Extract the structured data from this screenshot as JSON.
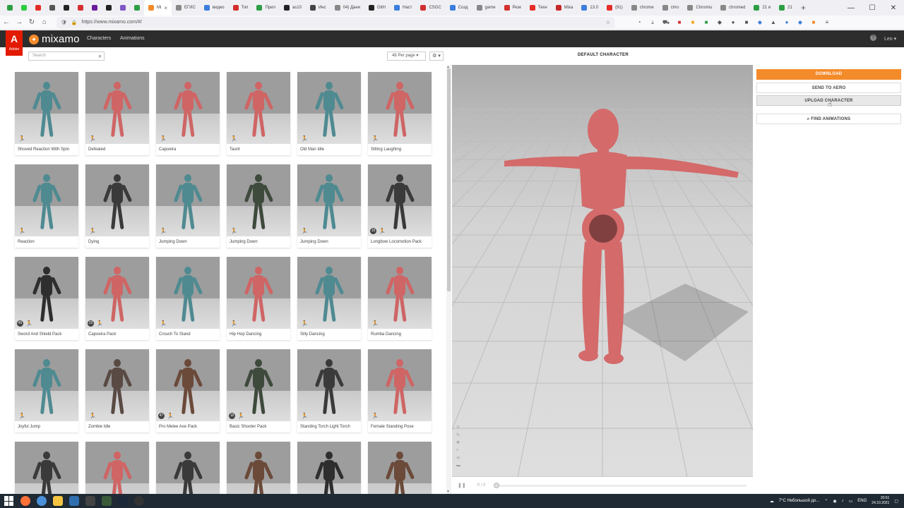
{
  "browser": {
    "tabs": [
      {
        "label": "",
        "color": "#2e9e44"
      },
      {
        "label": "",
        "color": "#2ecc40"
      },
      {
        "label": "",
        "color": "#e52d27"
      },
      {
        "label": "",
        "color": "#555555"
      },
      {
        "label": "",
        "color": "#222222"
      },
      {
        "label": "",
        "color": "#d32f2f"
      },
      {
        "label": "",
        "color": "#6a1b9a"
      },
      {
        "label": "",
        "color": "#222222"
      },
      {
        "label": "",
        "color": "#7e57c2"
      },
      {
        "label": "",
        "color": "#2e9e44"
      },
      {
        "label": "Mi",
        "color": "#f48b2b",
        "active": true
      },
      {
        "label": "ЕГИС",
        "color": "#888888"
      },
      {
        "label": "видео",
        "color": "#3b7ddd"
      },
      {
        "label": "Топ",
        "color": "#d32f2f"
      },
      {
        "label": "Прил",
        "color": "#2e9e44"
      },
      {
        "label": "as10",
        "color": "#222222"
      },
      {
        "label": "Инс",
        "color": "#444444"
      },
      {
        "label": "04) Дани",
        "color": "#888888"
      },
      {
        "label": "GitH",
        "color": "#222222"
      },
      {
        "label": "Наст",
        "color": "#3b7ddd"
      },
      {
        "label": "CSGC",
        "color": "#d32f2f"
      },
      {
        "label": "Созд",
        "color": "#3b7ddd"
      },
      {
        "label": "game",
        "color": "#888888"
      },
      {
        "label": "Резк",
        "color": "#d32f2f"
      },
      {
        "label": "Техн",
        "color": "#e52d27"
      },
      {
        "label": "Mixa",
        "color": "#c62828"
      },
      {
        "label": "13.0",
        "color": "#3b7ddd"
      },
      {
        "label": "(91)",
        "color": "#e52d27"
      },
      {
        "label": "chrome",
        "color": "#888888"
      },
      {
        "label": "chro",
        "color": "#888888"
      },
      {
        "label": "Chromiu",
        "color": "#888888"
      },
      {
        "label": "chromed",
        "color": "#888888"
      },
      {
        "label": "21 и",
        "color": "#2e9e44"
      },
      {
        "label": "21",
        "color": "#2e9e44"
      }
    ],
    "tab_close": "×",
    "tab_add": "+",
    "url": "https://www.mixamo.com/#/",
    "window_controls": [
      "—",
      "☐",
      "✕"
    ]
  },
  "app": {
    "adobe_logo": "A",
    "adobe_text": "Adobe",
    "brand": "mixamo",
    "nav": [
      "Characters",
      "Animations"
    ],
    "help": "?",
    "user": "Leo ▾"
  },
  "toolbar": {
    "search_placeholder": "Search",
    "per_page": "48 Per page ▾",
    "settings": "⚙ ▾"
  },
  "grid": [
    {
      "label": "Shoved Reaction With Spin",
      "color": "#4f8a91",
      "badge": ""
    },
    {
      "label": "Defeated",
      "color": "#cf6565",
      "badge": ""
    },
    {
      "label": "Capoeira",
      "color": "#cf6565",
      "badge": ""
    },
    {
      "label": "Taunt",
      "color": "#cf6565",
      "badge": ""
    },
    {
      "label": "Old Man Idle",
      "color": "#4f8a91",
      "badge": ""
    },
    {
      "label": "Sitting Laughing",
      "color": "#cf6565",
      "badge": ""
    },
    {
      "label": "Reaction",
      "color": "#4f8a91",
      "badge": ""
    },
    {
      "label": "Dying",
      "color": "#3a3a3a",
      "badge": ""
    },
    {
      "label": "Jumping Down",
      "color": "#4f8a91",
      "badge": ""
    },
    {
      "label": "Jumping Down",
      "color": "#3e4a3c",
      "badge": ""
    },
    {
      "label": "Jumping Down",
      "color": "#4f8a91",
      "badge": ""
    },
    {
      "label": "Longbow Locomotion Pack",
      "color": "#3a3a3a",
      "badge": "15"
    },
    {
      "label": "Sword And Shield Pack",
      "color": "#2e2e2e",
      "badge": "45"
    },
    {
      "label": "Capoeira Pack",
      "color": "#cf6565",
      "badge": "23"
    },
    {
      "label": "Crouch To Stand",
      "color": "#4f8a91",
      "badge": ""
    },
    {
      "label": "Hip Hop Dancing",
      "color": "#cf6565",
      "badge": ""
    },
    {
      "label": "Silly Dancing",
      "color": "#4f8a91",
      "badge": ""
    },
    {
      "label": "Rumba Dancing",
      "color": "#cf6565",
      "badge": ""
    },
    {
      "label": "Joyful Jump",
      "color": "#4f8a91",
      "badge": ""
    },
    {
      "label": "Zombie Idle",
      "color": "#5a4a44",
      "badge": ""
    },
    {
      "label": "Pro Melee Axe Pack",
      "color": "#6b4a3a",
      "badge": "47"
    },
    {
      "label": "Basic Shooter Pack",
      "color": "#3e4a3c",
      "badge": "16"
    },
    {
      "label": "Standing Torch Light Torch",
      "color": "#3a3a3a",
      "badge": ""
    },
    {
      "label": "Female Standing Pose",
      "color": "#cf6565",
      "badge": ""
    },
    {
      "label": "",
      "color": "#3a3a3a",
      "badge": ""
    },
    {
      "label": "",
      "color": "#cf6565",
      "badge": ""
    },
    {
      "label": "",
      "color": "#3a3a3a",
      "badge": ""
    },
    {
      "label": "",
      "color": "#6b4a3a",
      "badge": ""
    },
    {
      "label": "",
      "color": "#2e2e2e",
      "badge": ""
    },
    {
      "label": "",
      "color": "#6b4a3a",
      "badge": ""
    }
  ],
  "viewport": {
    "title": "DEFAULT CHARACTER",
    "frame_counter": "0 / 0",
    "character_color": "#d46a6a"
  },
  "panel": {
    "download": "DOWNLOAD",
    "send_to_aero": "SEND TO AERO",
    "upload_character": "UPLOAD CHARACTER",
    "find_animations": "FIND ANIMATIONS"
  },
  "taskbar": {
    "weather": "7°C  Небольшой до...",
    "lang": "ENG",
    "time": "20:51",
    "date": "24.10.2021"
  }
}
